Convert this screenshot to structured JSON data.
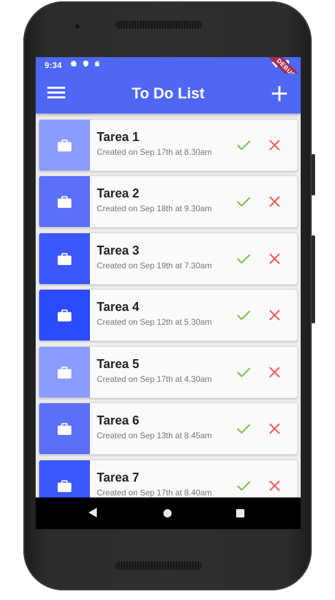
{
  "status_bar": {
    "time": "9:34",
    "debug_label": "DEBUG"
  },
  "app_bar": {
    "title": "To Do List"
  },
  "tasks": [
    {
      "title": "Tarea 1",
      "subtitle": "Created on Sep 17th at 8.30am",
      "color": "#8b9bff"
    },
    {
      "title": "Tarea 2",
      "subtitle": "Created on Sep 18th at 9.30am",
      "color": "#5a70fb"
    },
    {
      "title": "Tarea 3",
      "subtitle": "Created on Sep 19th at 7.30am",
      "color": "#3b58ff"
    },
    {
      "title": "Tarea 4",
      "subtitle": "Created on Sep 12th at 5.30am",
      "color": "#2a4bff"
    },
    {
      "title": "Tarea 5",
      "subtitle": "Created on Sep 17th at 4.30am",
      "color": "#8b9bff"
    },
    {
      "title": "Tarea 6",
      "subtitle": "Created on Sep 13th at 8.45am",
      "color": "#5a70fb"
    },
    {
      "title": "Tarea 7",
      "subtitle": "Created on Sep 17th at 8.40am",
      "color": "#3b58ff"
    }
  ],
  "colors": {
    "primary": "#4f67f5",
    "check": "#7cc04b",
    "delete": "#f25c5c"
  },
  "icons": {
    "menu": "menu-icon",
    "add": "plus-icon",
    "task": "briefcase-icon",
    "complete": "check-icon",
    "delete": "close-icon"
  }
}
